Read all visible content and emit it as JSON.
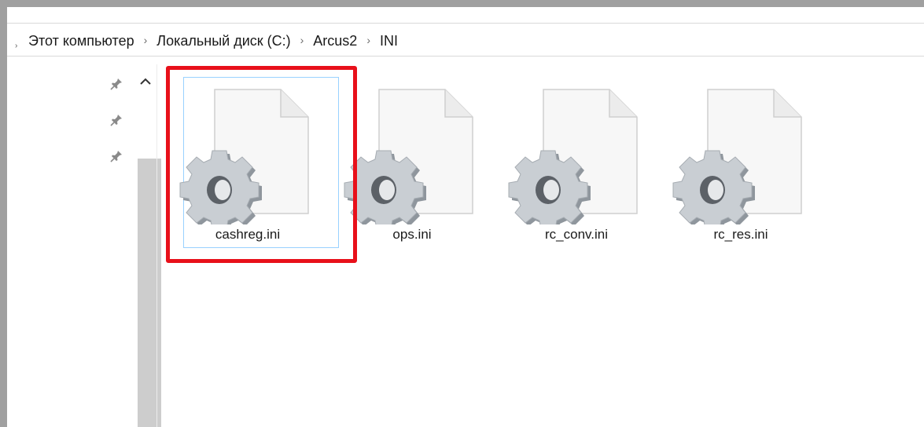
{
  "breadcrumb": [
    "Этот компьютер",
    "Локальный диск (C:)",
    "Arcus2",
    "INI"
  ],
  "separator_glyph": "›",
  "files": [
    {
      "name": "cashreg.ini",
      "icon": "ini-settings-file-icon",
      "selected": true
    },
    {
      "name": "ops.ini",
      "icon": "ini-settings-file-icon",
      "selected": false
    },
    {
      "name": "rc_conv.ini",
      "icon": "ini-settings-file-icon",
      "selected": false
    },
    {
      "name": "rc_res.ini",
      "icon": "ini-settings-file-icon",
      "selected": false
    }
  ],
  "nav_pane": {
    "pins": [
      "pin-icon",
      "pin-icon",
      "pin-icon"
    ],
    "scroll_up": "chevron-up-icon"
  },
  "colors": {
    "highlight": "#e8101a",
    "selection_border": "#99d1ff",
    "frame": "#a0a0a0",
    "scroll_thumb": "#cdcdcd"
  }
}
